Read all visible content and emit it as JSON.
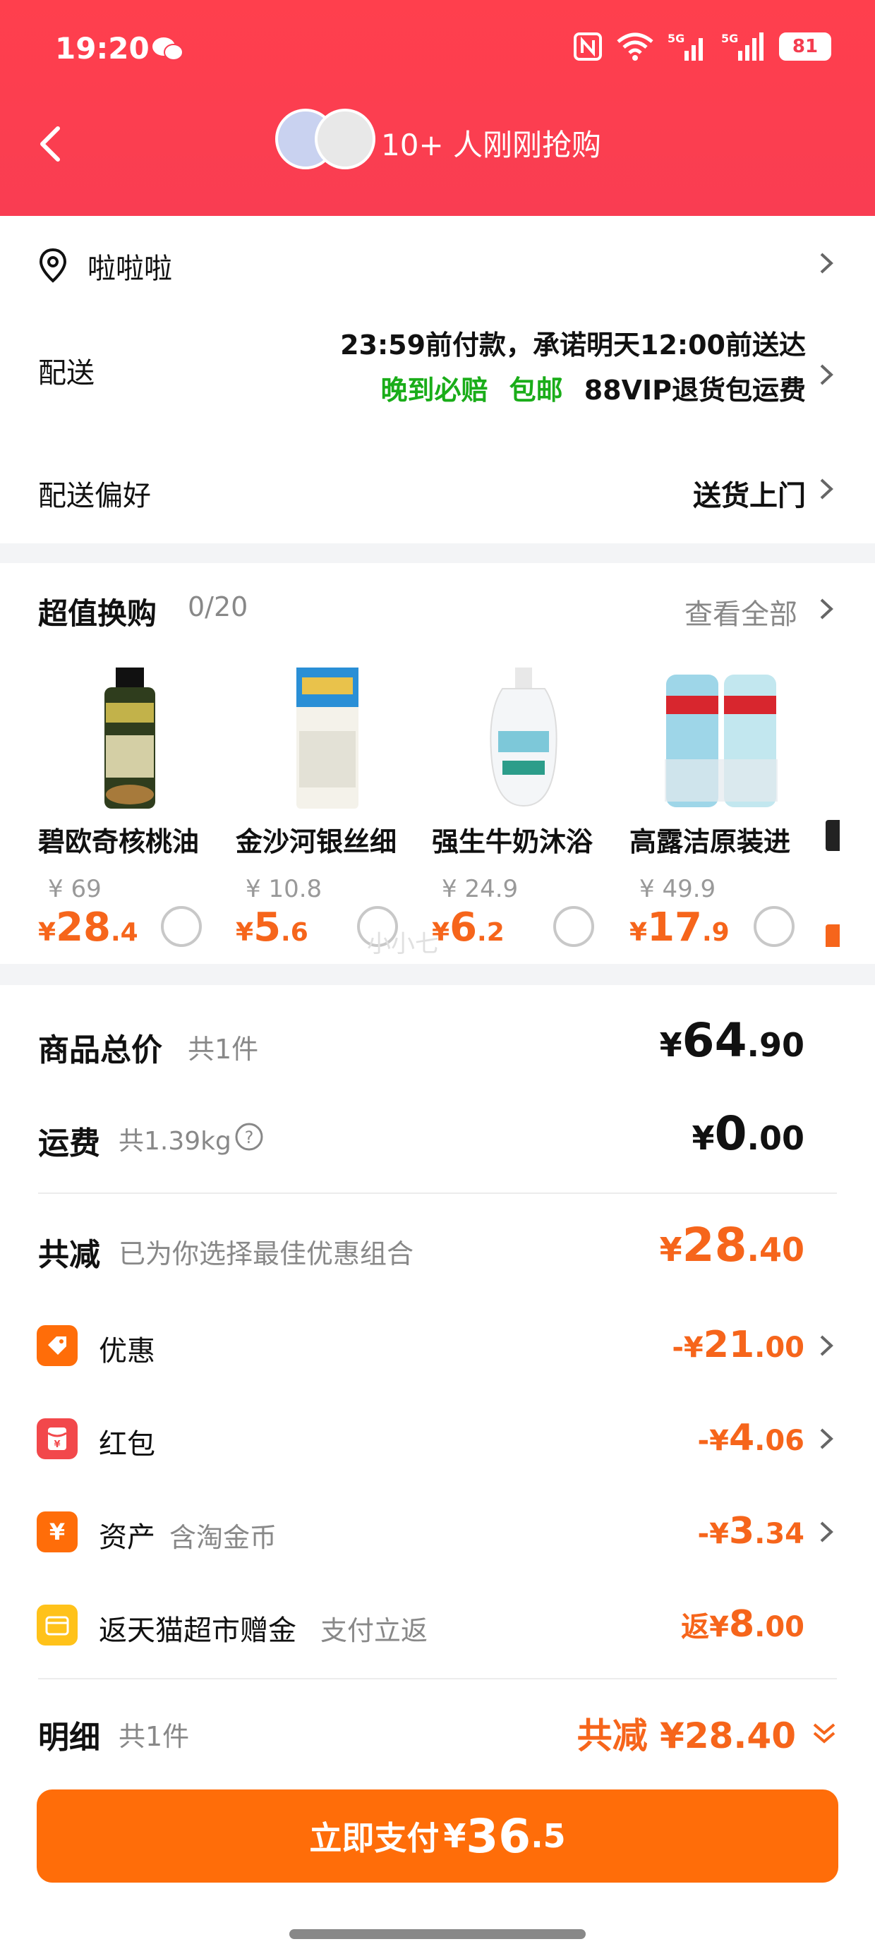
{
  "status_bar": {
    "time": "19:20",
    "battery": "81"
  },
  "nav": {
    "title": "10+ 人刚刚抢购"
  },
  "address": {
    "text": "啦啦啦"
  },
  "delivery": {
    "label": "配送",
    "line1": "23:59前付款，承诺明天12:00前送达",
    "tag1": "晚到必赔",
    "tag2": "包邮",
    "tag3": "88VIP退货包运费"
  },
  "delivery_pref": {
    "label": "配送偏好",
    "value": "送货上门"
  },
  "swap": {
    "title": "超值换购",
    "count": "0/20",
    "see_all": "查看全部",
    "items": [
      {
        "name": "碧欧奇核桃油",
        "orig": "¥ 69",
        "cur": "¥",
        "int": "28",
        "dec": ".4"
      },
      {
        "name": "金沙河银丝细",
        "orig": "¥ 10.8",
        "cur": "¥",
        "int": "5",
        "dec": ".6"
      },
      {
        "name": "强生牛奶沐浴",
        "orig": "¥ 24.9",
        "cur": "¥",
        "int": "6",
        "dec": ".2"
      },
      {
        "name": "高露洁原装进",
        "orig": "¥ 49.9",
        "cur": "¥",
        "int": "17",
        "dec": ".9"
      }
    ],
    "watermark": "小小七"
  },
  "summary": {
    "goods_label": "商品总价",
    "goods_sub": "共1件",
    "goods_cur": "¥",
    "goods_int": "64",
    "goods_dec": ".90",
    "ship_label": "运费",
    "ship_sub": "共1.39kg",
    "ship_cur": "¥",
    "ship_int": "0",
    "ship_dec": ".00",
    "discount_label": "共减",
    "discount_sub": "已为你选择最佳优惠组合",
    "discount_cur": "¥",
    "discount_int": "28",
    "discount_dec": ".40"
  },
  "discounts": [
    {
      "label": "优惠",
      "sub": "",
      "prefix": "-¥",
      "int": "21",
      "dec": ".00",
      "icon": "tag-icon",
      "color": "#ff6d09"
    },
    {
      "label": "红包",
      "sub": "",
      "prefix": "-¥",
      "int": "4",
      "dec": ".06",
      "icon": "red-packet-icon",
      "color": "#f2484b"
    },
    {
      "label": "资产",
      "sub": "含淘金币",
      "prefix": "-¥",
      "int": "3",
      "dec": ".34",
      "icon": "yuan-coin-icon",
      "color": "#ff6d09"
    },
    {
      "label": "返天猫超市赠金",
      "sub": "支付立返",
      "prefix": "返¥",
      "int": "8",
      "dec": ".00",
      "icon": "wallet-icon",
      "color": "#ffc21a"
    }
  ],
  "detail": {
    "label": "明细",
    "sub": "共1件",
    "total": "共减 ¥28.40"
  },
  "pay_button": {
    "label": "立即支付",
    "cur": "¥",
    "int": "36",
    "dec": ".5"
  }
}
